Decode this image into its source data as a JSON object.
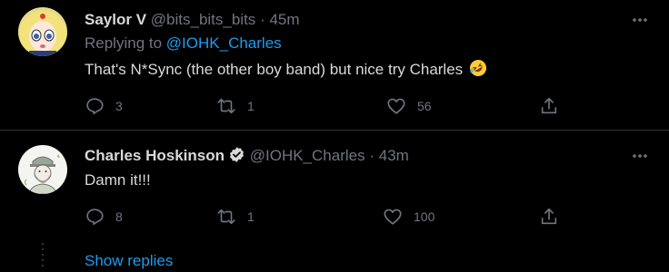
{
  "tweets": [
    {
      "author_name": "Saylor V",
      "author_handle": "@bits_bits_bits",
      "separator": "·",
      "time": "45m",
      "replying_prefix": "Replying to",
      "replying_to": "@IOHK_Charles",
      "text": "That's N*Sync (the other boy band) but nice try Charles",
      "emoji": "rolling-on-floor-laughing",
      "replies": "3",
      "retweets": "1",
      "likes": "56"
    },
    {
      "author_name": "Charles Hoskinson",
      "author_handle": "@IOHK_Charles",
      "separator": "·",
      "time": "43m",
      "verified": true,
      "text": "Damn it!!!",
      "replies": "8",
      "retweets": "1",
      "likes": "100"
    }
  ],
  "show_replies_label": "Show replies",
  "colors": {
    "background": "#000000",
    "text": "#d9d9d9",
    "secondary": "#6e767d",
    "accent": "#1d9bf0",
    "divider": "#2f3336"
  }
}
